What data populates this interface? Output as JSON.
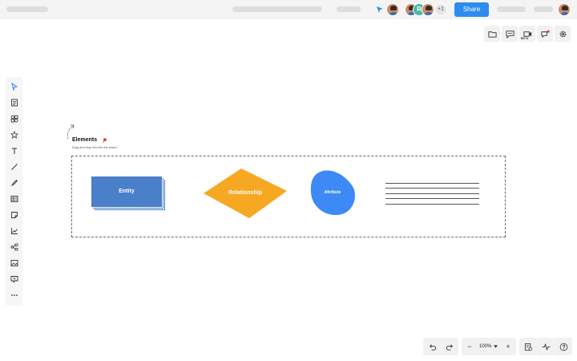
{
  "topbar": {
    "share_label": "Share",
    "more_collaborators": "+1",
    "collaborator_letter": "R",
    "cursor_color": "#2d8cf0"
  },
  "right_toolbar": {
    "icons": [
      "folder-icon",
      "comment-icon",
      "video-icon",
      "chat-icon",
      "settings-icon"
    ],
    "video_badge": "BETA"
  },
  "left_toolbar": {
    "tools": [
      "select-icon",
      "notes-icon",
      "shapes-icon",
      "star-icon",
      "text-icon",
      "line-icon",
      "pen-icon",
      "table-icon",
      "sticky-note-icon",
      "chart-icon",
      "diagram-icon",
      "image-icon",
      "embed-icon",
      "more-icon"
    ]
  },
  "canvas": {
    "title": "Elements",
    "subtitle": "Drag and drop this into the board.",
    "entity": {
      "label": "Entity",
      "color": "#4a7fc9"
    },
    "relationship": {
      "label": "Relationship",
      "color": "#f7a823"
    },
    "attribute": {
      "label": "Attribute",
      "color": "#3d8af7"
    },
    "lines_count": 5
  },
  "bottom_toolbar": {
    "zoom": "100%",
    "zoom_out": "−",
    "zoom_in": "+"
  }
}
